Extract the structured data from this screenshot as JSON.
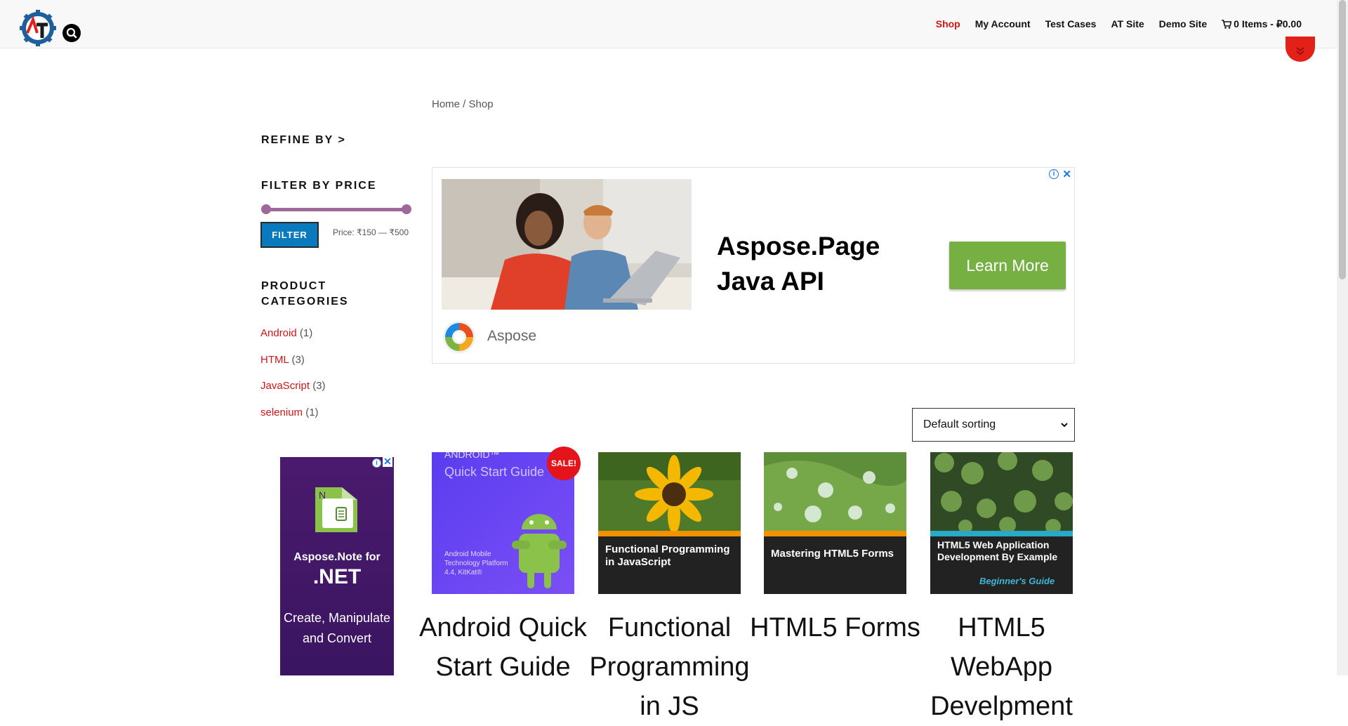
{
  "header": {
    "nav": [
      "Shop",
      "My Account",
      "Test Cases",
      "AT Site",
      "Demo Site"
    ],
    "cart_label": "0 Items - ₽0.00"
  },
  "breadcrumb": "Home / Shop",
  "sidebar": {
    "refine_title": "REFINE BY >",
    "filter_title": "FILTER BY PRICE",
    "filter_button": "FILTER",
    "price_text": "Price: ₹150 — ₹500",
    "categories_title": "PRODUCT CATEGORIES",
    "categories": [
      {
        "name": "Android",
        "count": "(1)"
      },
      {
        "name": "HTML",
        "count": "(3)"
      },
      {
        "name": "JavaScript",
        "count": "(3)"
      },
      {
        "name": "selenium",
        "count": "(1)"
      }
    ]
  },
  "ad": {
    "title": "Aspose.Page Java API",
    "button": "Learn More",
    "brand": "Aspose",
    "close": "✕"
  },
  "sort": {
    "value": "Default sorting"
  },
  "side_ad": {
    "line1": "Aspose.Note for",
    "line2": ".NET",
    "desc": "Create, Manipulate and Convert",
    "close": "✕"
  },
  "products": [
    {
      "title": "Android Quick Start Guide",
      "sale": "SALE!"
    },
    {
      "title": "Functional Programming in JS",
      "cover_title": "Functional Programming in JavaScript"
    },
    {
      "title": "HTML5 Forms",
      "cover_title": "Mastering HTML5 Forms"
    },
    {
      "title": "HTML5 WebApp Develpment",
      "cover_title": "HTML5 Web Application Development By Example",
      "cover_tag": "Beginner's Guide"
    }
  ],
  "colors": {
    "accent": "#d11515",
    "filter_button": "#0a7abf",
    "slider": "#a0679a",
    "ad_button": "#76b043"
  }
}
